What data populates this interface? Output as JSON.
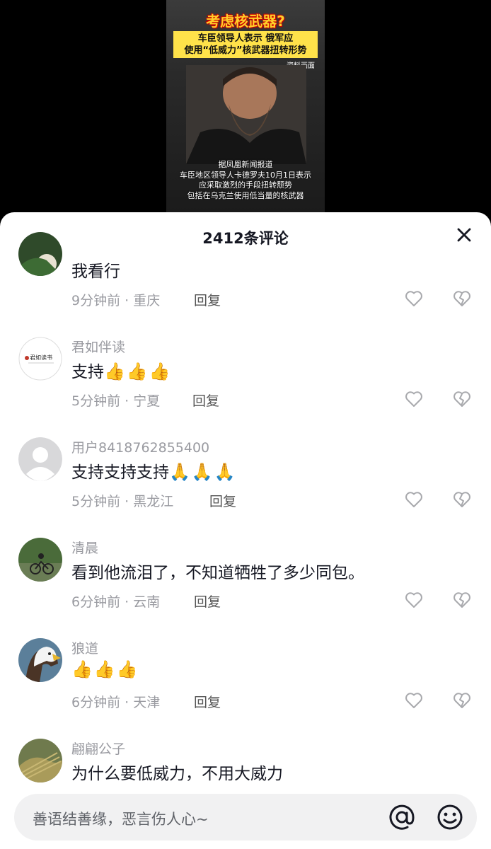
{
  "video": {
    "title": "考虑核武器?",
    "banner_line1": "车臣领导人表示 俄军应",
    "banner_line2": "使用“低威力”核武器扭转形势",
    "source_tag": "资料画面",
    "caption_line1": "据凤凰新闻报道",
    "caption_line2": "车臣地区领导人卡德罗夫10月1日表示",
    "caption_line3": "应采取激烈的手段扭转颓势",
    "caption_line4": "包括在乌克兰使用低当量的核武器"
  },
  "sheet": {
    "title": "2412条评论"
  },
  "reply_label": "回复",
  "comments": [
    {
      "username": "",
      "text": "我看行",
      "meta": "9分钟前 · 重庆"
    },
    {
      "username": "君如伴读",
      "text": "支持",
      "emoji": "👍👍👍",
      "meta": "5分钟前 · 宁夏"
    },
    {
      "username": "用户8418762855400",
      "text": "支持支持支持",
      "emoji": "🙏🙏🙏",
      "meta": "5分钟前 · 黑龙江"
    },
    {
      "username": "清晨",
      "text": "看到他流泪了，不知道牺牲了多少同包。",
      "meta": "6分钟前 · 云南"
    },
    {
      "username": "狼道",
      "text": "",
      "emoji": "👍👍👍",
      "meta": "6分钟前 · 天津"
    },
    {
      "username": "翩翩公子",
      "text": "为什么要低威力，不用大威力",
      "meta": ""
    }
  ],
  "input": {
    "placeholder": "善语结善缘，恶言伤人心~"
  },
  "icons": [
    "close-icon",
    "heart-icon",
    "broken-heart-icon",
    "at-icon",
    "smile-icon"
  ]
}
